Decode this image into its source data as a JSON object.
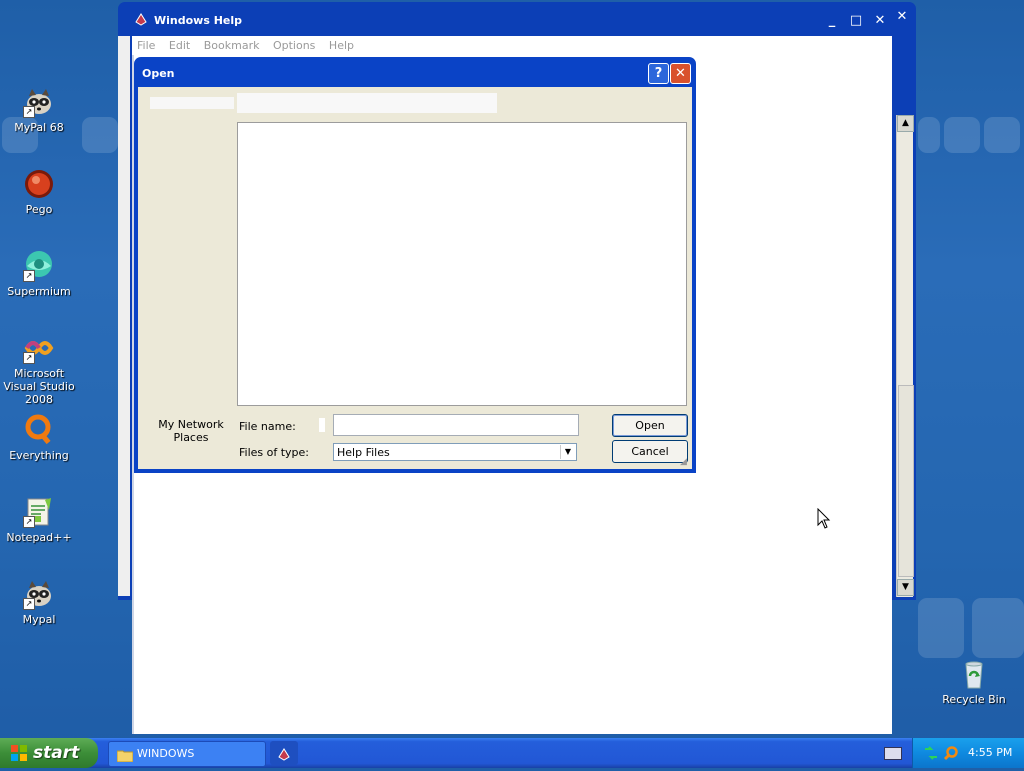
{
  "desktop": {
    "icons": [
      {
        "label": "MyPal 68",
        "icon": "mypal-icon"
      },
      {
        "label": "Pego",
        "icon": "pego-icon"
      },
      {
        "label": "Supermium",
        "icon": "supermium-icon"
      },
      {
        "label": "Microsoft Visual Studio 2008",
        "icon": "visual-studio-icon"
      },
      {
        "label": "Everything",
        "icon": "everything-icon"
      },
      {
        "label": "Notepad++",
        "icon": "notepadpp-icon"
      },
      {
        "label": "Mypal",
        "icon": "mypal-icon"
      },
      {
        "label": "Recycle Bin",
        "icon": "recycle-bin-icon"
      }
    ]
  },
  "help_window": {
    "title": "Windows Help",
    "menu": [
      "File",
      "Edit",
      "Bookmark",
      "Options",
      "Help"
    ]
  },
  "open_dialog": {
    "title": "Open",
    "places_label": "My Network Places",
    "file_name_label": "File name:",
    "file_name_value": "",
    "files_of_type_label": "Files of type:",
    "files_of_type_value": "Help Files",
    "open_button": "Open",
    "cancel_button": "Cancel"
  },
  "taskbar": {
    "start_label": "start",
    "task_windows": "WINDOWS",
    "clock": "4:55 PM"
  },
  "colors": {
    "titlebar": "#0a43c6",
    "taskbar": "#245edb",
    "start": "#3c8e38",
    "tray": "#0f8ae0"
  }
}
